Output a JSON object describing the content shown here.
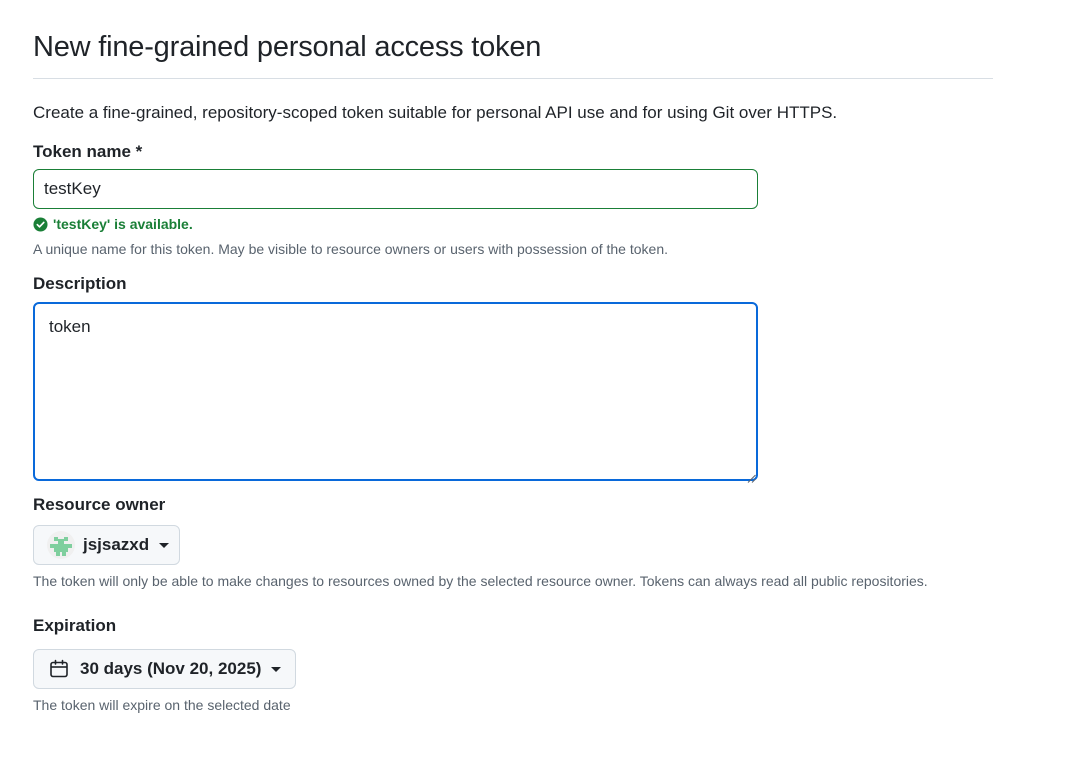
{
  "page": {
    "title": "New fine-grained personal access token",
    "subtitle": "Create a fine-grained, repository-scoped token suitable for personal API use and for using Git over HTTPS."
  },
  "token_name": {
    "label": "Token name *",
    "value": "testKey",
    "validation": "'testKey' is available.",
    "note": "A unique name for this token. May be visible to resource owners or users with possession of the token."
  },
  "description": {
    "label": "Description",
    "value": "token"
  },
  "resource_owner": {
    "label": "Resource owner",
    "selected": "jsjsazxd",
    "note": "The token will only be able to make changes to resources owned by the selected resource owner. Tokens can always read all public repositories."
  },
  "expiration": {
    "label": "Expiration",
    "selected": "30 days (Nov 20, 2025)",
    "note": "The token will expire on the selected date"
  },
  "icons": {
    "validation": "check-circle-icon",
    "owner_dropdown": "caret-down-icon",
    "expiration": "calendar-icon"
  },
  "colors": {
    "success": "#1a7f37",
    "focus": "#0969da",
    "muted_text": "#59636e",
    "avatar": "#7fcf9e"
  }
}
